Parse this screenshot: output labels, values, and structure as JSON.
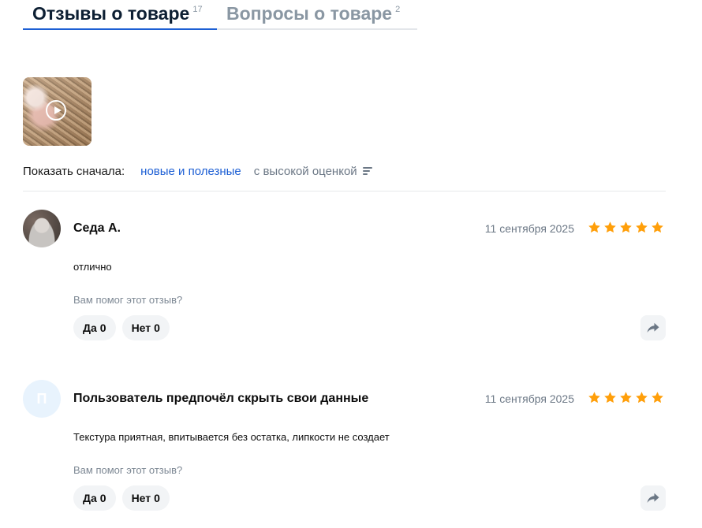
{
  "tabs": [
    {
      "label": "Отзывы о товаре",
      "count": "17",
      "active": true
    },
    {
      "label": "Вопросы о товаре",
      "count": "2",
      "active": false
    }
  ],
  "media": {
    "icon": "play-icon"
  },
  "sort": {
    "label": "Показать сначала:",
    "options": [
      {
        "label": "новые и полезные",
        "active": true
      },
      {
        "label": "с высокой оценкой",
        "active": false
      }
    ],
    "icon": "sort-lines-icon"
  },
  "reviews": [
    {
      "author": "Седа А.",
      "avatar_type": "photo",
      "avatar_letter": "",
      "date": "11 сентября 2025",
      "rating": 5,
      "text": "отлично",
      "helpful_question": "Вам помог этот отзыв?",
      "yes_label": "Да",
      "yes_count": "0",
      "no_label": "Нет",
      "no_count": "0"
    },
    {
      "author": "Пользователь предпочёл скрыть свои данные",
      "avatar_type": "letter",
      "avatar_letter": "П",
      "date": "11 сентября 2025",
      "rating": 5,
      "text": "Текстура приятная, впитывается без остатка, липкости не создает",
      "helpful_question": "Вам помог этот отзыв?",
      "yes_label": "Да",
      "yes_count": "0",
      "no_label": "Нет",
      "no_count": "0"
    }
  ],
  "colors": {
    "accent": "#1d5fd4",
    "star": "#ff9f0a",
    "muted": "#6b7785",
    "button_bg": "#f2f4f6"
  }
}
